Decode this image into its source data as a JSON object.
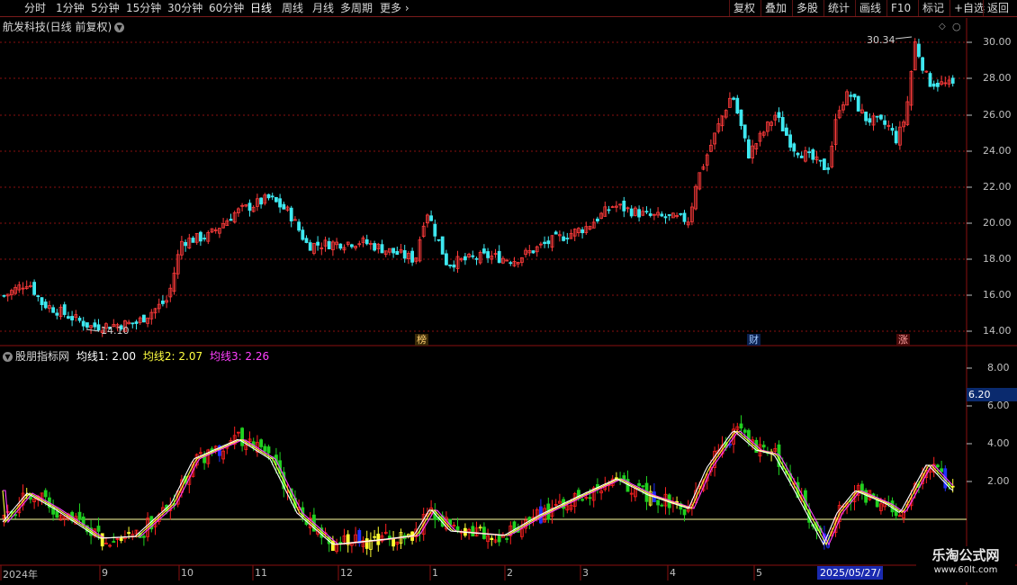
{
  "toolbar": {
    "periods": [
      "分时",
      "1分钟",
      "5分钟",
      "15分钟",
      "30分钟",
      "60分钟",
      "日线",
      "周线",
      "月线",
      "多周期",
      "更多"
    ],
    "active": "日线",
    "right_buttons": [
      "复权",
      "叠加",
      "多股",
      "统计",
      "画线",
      "F10",
      "标记",
      "+自选",
      "返回"
    ]
  },
  "main_panel": {
    "title": "航发科技(日线 前复权)",
    "high_label": "30.34",
    "low_label": "14.10",
    "y_ticks": [
      "30.00",
      "28.00",
      "26.00",
      "24.00",
      "22.00",
      "20.00",
      "18.00",
      "16.00",
      "14.00"
    ],
    "events": [
      "榜",
      "财",
      "涨"
    ]
  },
  "indicator_panel": {
    "title": "股朋指标网",
    "ma1_label": "均线1: 2.00",
    "ma2_label": "均线2: 2.07",
    "ma3_label": "均线3: 2.26",
    "y_ticks": [
      "8.00",
      "6.00",
      "4.00",
      "2.00"
    ],
    "value_tag": "6.20"
  },
  "x_axis": {
    "start": "2024年",
    "months": [
      "9",
      "10",
      "11",
      "12",
      "1",
      "2",
      "3",
      "4",
      "5"
    ],
    "cursor_date": "2025/05/27/"
  },
  "watermark": {
    "line1": "乐淘公式网",
    "line2": "www.60lt.com"
  },
  "colors": {
    "up": "#ff3b3b",
    "down": "#3ee8f0",
    "ind_up": "#ff2020",
    "ind_down": "#20d020",
    "ind_blue": "#2030ff",
    "ind_yellow": "#ffff30",
    "ma1": "#ffffff",
    "ma2": "#ffff40",
    "ma3": "#ff40ff",
    "grid": "#8a1010"
  }
}
